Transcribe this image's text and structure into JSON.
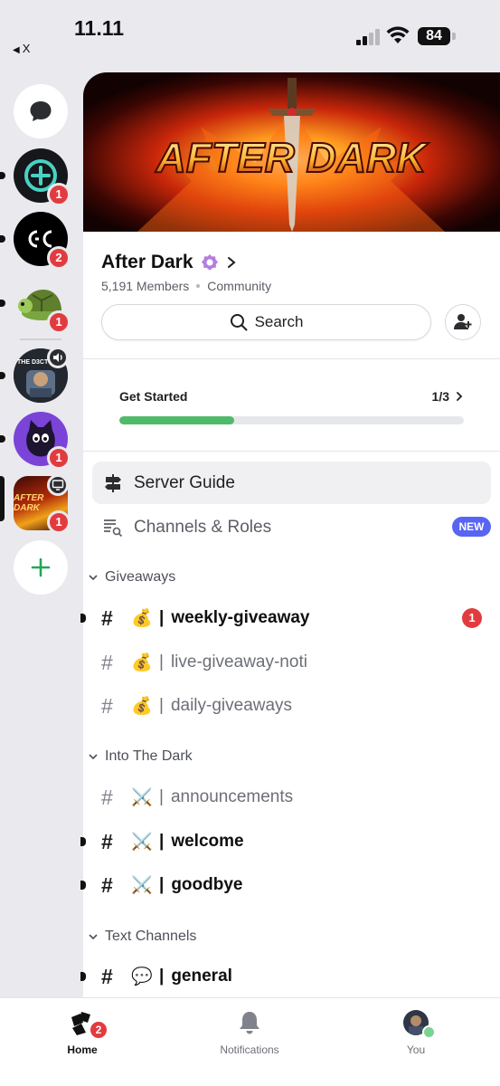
{
  "status_bar": {
    "time": "11.11",
    "back_label": "X",
    "battery": "84"
  },
  "server": {
    "banner_title": "AFTER DARK",
    "name": "After Dark",
    "members": "5,191 Members",
    "type": "Community",
    "search_label": "Search"
  },
  "get_started": {
    "label": "Get Started",
    "progress_text": "1/3",
    "progress_fraction": 0.333
  },
  "rows": {
    "server_guide": "Server Guide",
    "channels_roles": "Channels & Roles",
    "new_badge": "NEW"
  },
  "rail": {
    "badges": [
      "1",
      "2",
      "1",
      "1",
      "1"
    ],
    "dark_avatar_text": "THE D3CT",
    "selected_server_text": "AFTER DARK"
  },
  "categories": {
    "giveaways": "Giveaways",
    "into_the_dark": "Into The Dark",
    "text_channels": "Text Channels"
  },
  "channels": {
    "weekly": {
      "emoji": "💰",
      "name": "weekly-giveaway",
      "badge": "1"
    },
    "live": {
      "emoji": "💰",
      "name": "live-giveaway-noti"
    },
    "daily": {
      "emoji": "💰",
      "name": "daily-giveaways"
    },
    "announcements": {
      "emoji": "⚔️",
      "name": "announcements"
    },
    "welcome": {
      "emoji": "⚔️",
      "name": "welcome"
    },
    "goodbye": {
      "emoji": "⚔️",
      "name": "goodbye"
    },
    "general": {
      "emoji": "💬",
      "name": "general"
    }
  },
  "channel_prefix": {
    "hash": "#",
    "separator": "|"
  },
  "bottom_nav": {
    "home": "Home",
    "home_badge": "2",
    "notifications": "Notifications",
    "you": "You"
  },
  "colors": {
    "accent_blurple": "#5865f2",
    "badge_red": "#e23b3f",
    "progress_green": "#4fba6a",
    "online_green": "#7bd392"
  }
}
